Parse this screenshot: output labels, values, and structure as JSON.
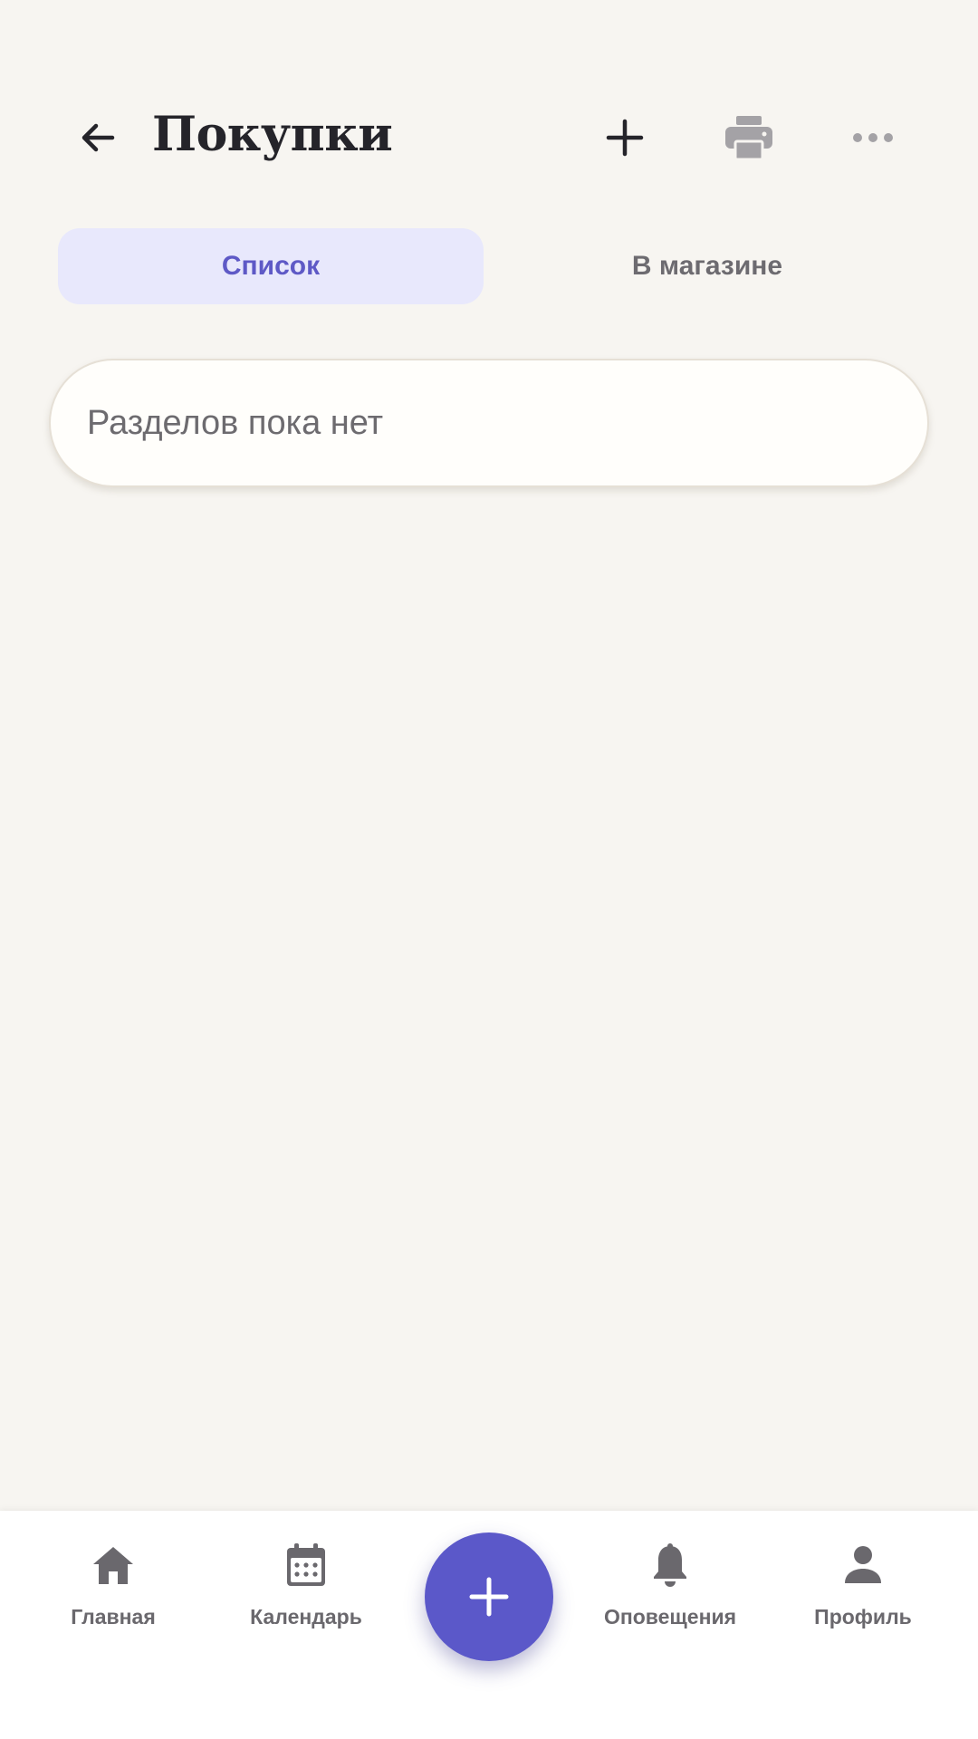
{
  "header": {
    "title": "Покупки",
    "back_icon": "arrow-left-icon",
    "actions": [
      {
        "icon": "plus-icon"
      },
      {
        "icon": "printer-icon"
      },
      {
        "icon": "more-horizontal-icon"
      }
    ]
  },
  "tabs": [
    {
      "label": "Список",
      "active": true
    },
    {
      "label": "В магазине",
      "active": false
    }
  ],
  "empty_state": {
    "text": "Разделов пока нет"
  },
  "bottom_nav": {
    "items": [
      {
        "label": "Главная",
        "icon": "home-icon"
      },
      {
        "label": "Календарь",
        "icon": "calendar-icon"
      },
      {
        "label": "Оповещения",
        "icon": "bell-icon"
      },
      {
        "label": "Профиль",
        "icon": "person-icon"
      }
    ],
    "fab_icon": "plus-icon"
  },
  "colors": {
    "background": "#f7f5f1",
    "accent": "#5b58c9",
    "tab_active_bg": "#e8e8fc",
    "text_dark": "#25242a",
    "text_muted": "#6a686d"
  }
}
